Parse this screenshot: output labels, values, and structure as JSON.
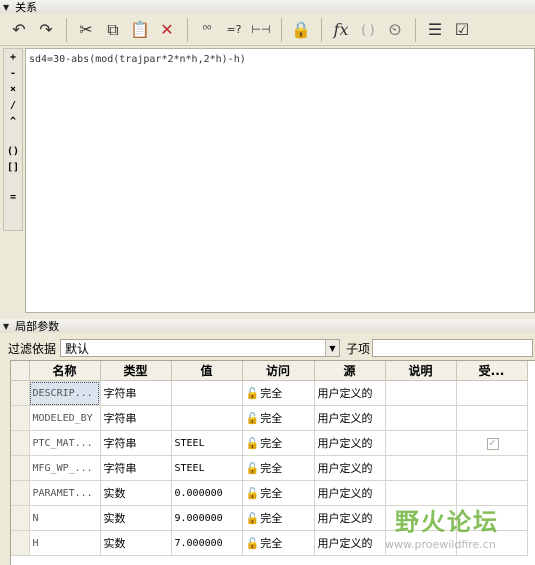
{
  "relations_panel": {
    "title": "关系"
  },
  "toolbar": {
    "buttons": [
      {
        "name": "undo",
        "glyph": "↶"
      },
      {
        "name": "redo",
        "glyph": "↷"
      },
      {
        "name": "cut",
        "glyph": "✂"
      },
      {
        "name": "copy",
        "glyph": "⧉"
      },
      {
        "name": "paste",
        "glyph": "📋"
      },
      {
        "name": "delete",
        "glyph": "✕"
      },
      {
        "name": "show-values",
        "glyph": "⁰⁰"
      },
      {
        "name": "evaluate",
        "glyph": "=?"
      },
      {
        "name": "measure",
        "glyph": "⊢⊣"
      },
      {
        "name": "unit-sensitive",
        "glyph": "🔒"
      },
      {
        "name": "insert-function",
        "glyph": "fx"
      },
      {
        "name": "insert-parentheses",
        "glyph": "( )"
      },
      {
        "name": "sort-relations",
        "glyph": "⏲"
      },
      {
        "name": "execute",
        "glyph": "☰"
      },
      {
        "name": "verify",
        "glyph": "☑"
      }
    ]
  },
  "operators": [
    "+",
    "-",
    "×",
    "/",
    "^",
    "()",
    "[]",
    "="
  ],
  "editor": {
    "text": "sd4=30-abs(mod(trajpar*2*n*h,2*h)-h)"
  },
  "params_panel": {
    "title": "局部参数"
  },
  "filter": {
    "label": "过滤依据",
    "value": "默认",
    "sub_label": "子项"
  },
  "table": {
    "columns": [
      "名称",
      "类型",
      "值",
      "访问",
      "源",
      "说明",
      "受..."
    ],
    "rows": [
      {
        "name": "DESCRIP...",
        "type": "字符串",
        "value": "",
        "access": "完全",
        "source": "用户定义的",
        "desc": "",
        "restricted": false,
        "selected": true
      },
      {
        "name": "MODELED_BY",
        "type": "字符串",
        "value": "",
        "access": "完全",
        "source": "用户定义的",
        "desc": "",
        "restricted": false,
        "selected": false
      },
      {
        "name": "PTC_MAT...",
        "type": "字符串",
        "value": "STEEL",
        "access": "完全",
        "source": "用户定义的",
        "desc": "",
        "restricted": true,
        "selected": false
      },
      {
        "name": "MFG_WP_...",
        "type": "字符串",
        "value": "STEEL",
        "access": "完全",
        "source": "用户定义的",
        "desc": "",
        "restricted": false,
        "selected": false
      },
      {
        "name": "PARAMET...",
        "type": "实数",
        "value": "0.000000",
        "access": "完全",
        "source": "用户定义的",
        "desc": "",
        "restricted": false,
        "selected": false
      },
      {
        "name": "N",
        "type": "实数",
        "value": "9.000000",
        "access": "完全",
        "source": "用户定义的",
        "desc": "",
        "restricted": false,
        "selected": false
      },
      {
        "name": "H",
        "type": "实数",
        "value": "7.000000",
        "access": "完全",
        "source": "用户定义的",
        "desc": "",
        "restricted": false,
        "selected": false
      }
    ]
  },
  "watermark": {
    "title": "野火论坛",
    "url": "www.proewildfire.cn"
  }
}
